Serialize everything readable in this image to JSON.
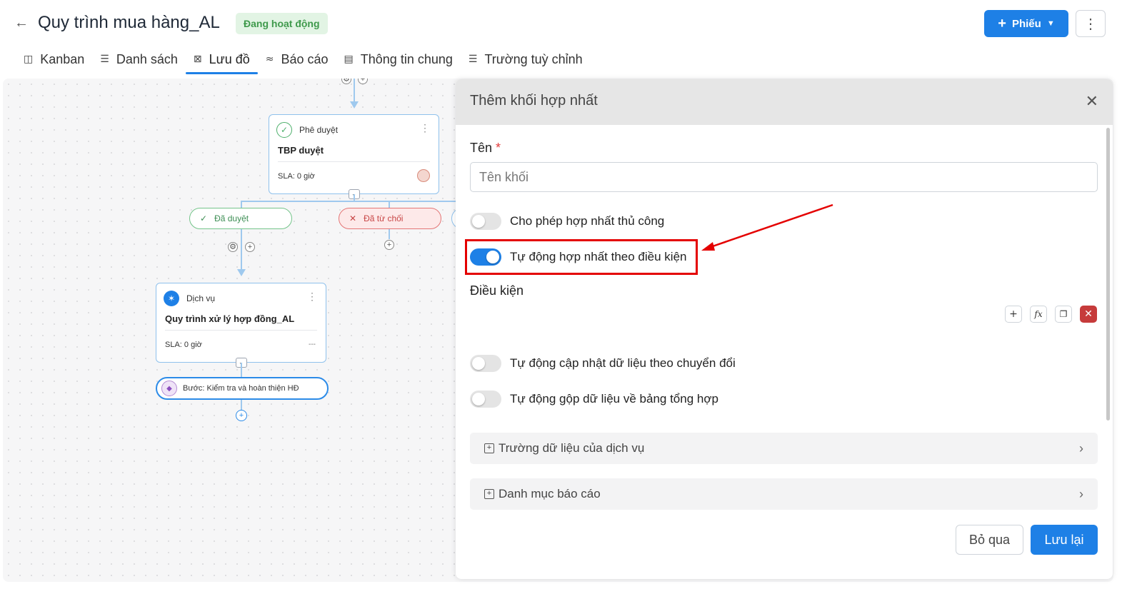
{
  "header": {
    "back_icon": "arrow-left-icon",
    "title": "Quy trình mua hàng_AL",
    "status": "Đang hoạt động",
    "primary_button": "Phiếu",
    "tabs": [
      {
        "label": "Kanban",
        "icon": "kanban-icon"
      },
      {
        "label": "Danh sách",
        "icon": "list-icon"
      },
      {
        "label": "Lưu đồ",
        "icon": "flowchart-icon"
      },
      {
        "label": "Báo cáo",
        "icon": "report-icon"
      },
      {
        "label": "Thông tin chung",
        "icon": "info-icon"
      },
      {
        "label": "Trường tuỳ chỉnh",
        "icon": "custom-fields-icon"
      }
    ],
    "active_tab": "Lưu đồ"
  },
  "canvas": {
    "approval_node": {
      "type": "Phê duyệt",
      "name": "TBP duyệt",
      "sla": "SLA: 0 giờ"
    },
    "branch_ok": "Đã duyệt",
    "branch_rejected": "Đã từ chối",
    "service_node": {
      "type": "Dịch vụ",
      "name": "Quy trình xử lý hợp đồng_AL",
      "sla": "SLA: 0 giờ",
      "assignee": "---"
    },
    "step": "Bước: Kiểm tra và hoàn thiện HĐ"
  },
  "panel": {
    "title": "Thêm khối hợp nhất",
    "name_label": "Tên",
    "required_mark": "*",
    "name_placeholder": "Tên khối",
    "toggles": [
      {
        "label": "Cho phép hợp nhất thủ công",
        "on": false
      },
      {
        "label": "Tự động hợp nhất theo điều kiện",
        "on": true
      },
      {
        "label": "Tự động cập nhật dữ liệu theo chuyển đổi",
        "on": false
      },
      {
        "label": "Tự động gộp dữ liệu về bảng tổng hợp",
        "on": false
      }
    ],
    "condition_label": "Điều kiện",
    "accordions": [
      "Trường dữ liệu của dịch vụ",
      "Danh mục báo cáo"
    ],
    "cancel_label": "Bỏ qua",
    "save_label": "Lưu lại"
  },
  "colors": {
    "accent": "#1e80e6",
    "status_bg": "#e2f4e4",
    "status_text": "#3f9a4c",
    "highlight": "#e40000"
  }
}
